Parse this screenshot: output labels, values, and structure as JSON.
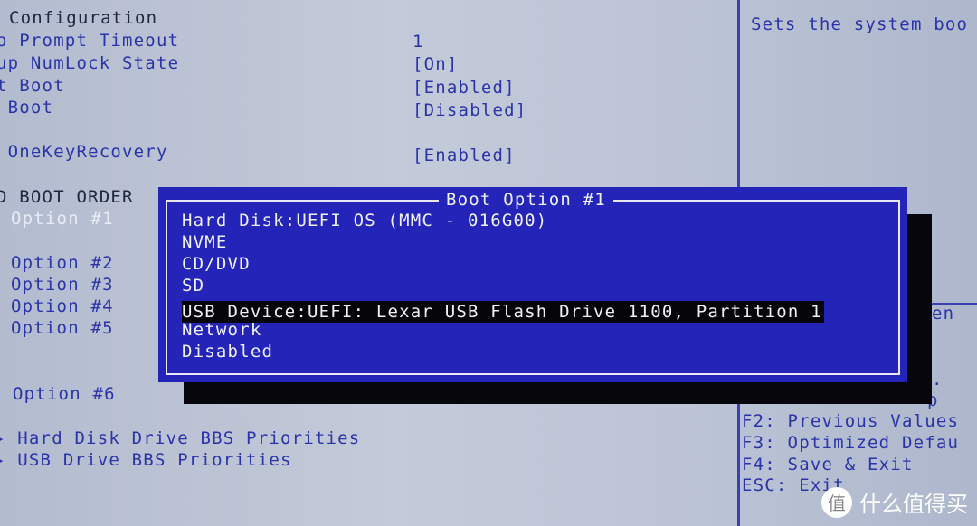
{
  "left": {
    "section_title": "Configuration",
    "settings": [
      {
        "label": "o Prompt Timeout",
        "value": "1"
      },
      {
        "label": "up NumLock State",
        "value": "[On]"
      },
      {
        "label": "t Boot",
        "value": "[Enabled]"
      },
      {
        "label": " Boot",
        "value": "[Disabled]"
      },
      {
        "label": " OneKeyRecovery",
        "value": "[Enabled]"
      }
    ],
    "boot_order_title": "D BOOT ORDER",
    "boot_options": [
      "Option #1",
      "Option #2",
      "Option #3",
      "Option #4",
      "Option #5",
      "Option #6"
    ],
    "links": [
      "Hard Disk Drive BBS Priorities",
      "USB Drive BBS Priorities"
    ]
  },
  "help": {
    "description": "Sets the system boo",
    "partial_lines": [
      "en",
      ".",
      "p"
    ],
    "keys": [
      "F2: Previous Values",
      "F3: Optimized Defau",
      "F4: Save & Exit",
      "ESC: Exit"
    ]
  },
  "dialog": {
    "title": "Boot Option #1",
    "options": [
      "Hard Disk:UEFI OS (MMC - 016G00)",
      "NVME",
      "CD/DVD",
      "SD",
      "USB Device:UEFI: Lexar USB Flash Drive 1100, Partition 1",
      "Network",
      "Disabled"
    ],
    "selected_index": 4
  },
  "watermark": {
    "logo": "值",
    "text": "什么值得买"
  }
}
